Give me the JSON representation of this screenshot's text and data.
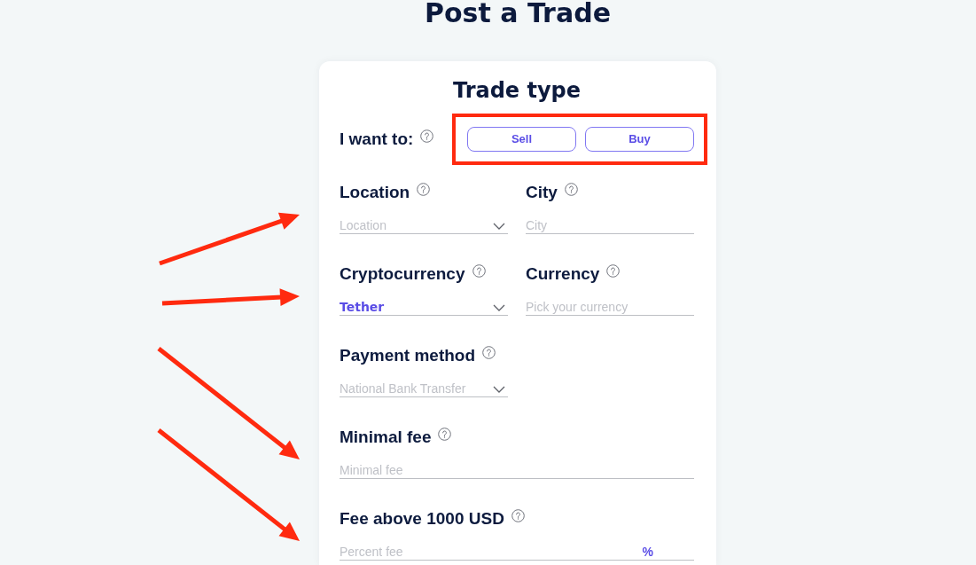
{
  "page_title": "Post a Trade",
  "form": {
    "title": "Trade type",
    "trade_direction": {
      "label": "I want to:",
      "highlighted": true,
      "options": [
        {
          "label": "Sell",
          "selected": false
        },
        {
          "label": "Buy",
          "selected": false
        }
      ]
    },
    "rows": [
      {
        "fields": [
          {
            "kind": "dropdown",
            "label": "Location",
            "placeholder": "Location",
            "wide": false,
            "arrow": {
              "kind": "rising"
            }
          },
          {
            "kind": "text",
            "label": "City",
            "placeholder": "City",
            "wide": false
          }
        ]
      },
      {
        "fields": [
          {
            "kind": "dropdown",
            "label": "Cryptocurrency",
            "value": "Tether",
            "wide": false,
            "arrow": {
              "kind": "flat"
            }
          },
          {
            "kind": "text",
            "label": "Currency",
            "placeholder": "Pick your currency",
            "wide": false
          }
        ]
      },
      {
        "fields": [
          {
            "kind": "dropdown",
            "label": "Payment method",
            "placeholder": "National Bank Transfer",
            "wide": false
          }
        ]
      },
      {
        "fields": [
          {
            "kind": "text",
            "label": "Minimal fee",
            "placeholder": "Minimal fee",
            "wide": true,
            "arrow": {
              "kind": "falling"
            }
          }
        ]
      },
      {
        "fields": [
          {
            "kind": "text",
            "label": "Fee above 1000 USD",
            "placeholder": "Percent fee",
            "suffix": "%",
            "wide": true,
            "arrow": {
              "kind": "falling"
            }
          }
        ]
      }
    ]
  }
}
